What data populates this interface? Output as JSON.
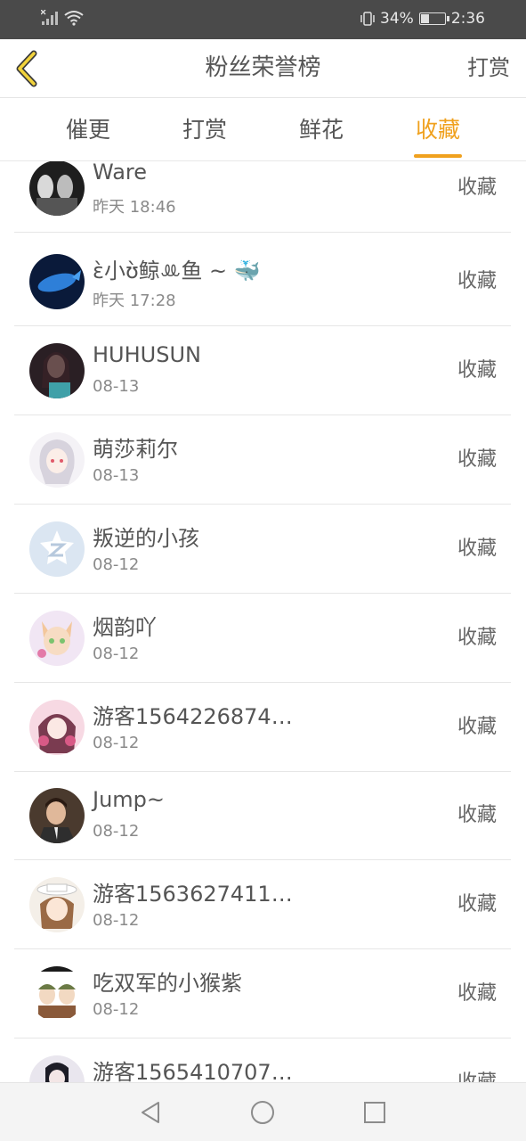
{
  "status_bar": {
    "battery_percent": "34%",
    "battery_level": 0.34,
    "time": "2:36",
    "icons": [
      "signal-icon",
      "wifi-icon",
      "vibrate-icon",
      "battery-icon"
    ]
  },
  "header": {
    "title": "粉丝荣誉榜",
    "action_label": "打赏",
    "back_icon": "chevron-left-icon",
    "accent_color": "#f0a11e"
  },
  "tabs": [
    {
      "label": "催更",
      "active": false
    },
    {
      "label": "打赏",
      "active": false
    },
    {
      "label": "鲜花",
      "active": false
    },
    {
      "label": "收藏",
      "active": true
    }
  ],
  "list": [
    {
      "name": "Ware",
      "time": "昨天 18:46",
      "action": "收藏",
      "avatar": "bw-photo"
    },
    {
      "name": "ɛ̀小ʊ̀鲸ꔛ鱼 ~ 🐳",
      "time": "昨天 17:28",
      "action": "收藏",
      "avatar": "blue-whale"
    },
    {
      "name": "HUHUSUN",
      "time": "08-13",
      "action": "收藏",
      "avatar": "portrait"
    },
    {
      "name": "萌莎莉尔",
      "time": "08-13",
      "action": "收藏",
      "avatar": "anime-girl"
    },
    {
      "name": "叛逆的小孩",
      "time": "08-12",
      "action": "收藏",
      "avatar": "default-z"
    },
    {
      "name": "烟韵吖",
      "time": "08-12",
      "action": "收藏",
      "avatar": "anime-fox"
    },
    {
      "name": "游客1564226874…",
      "time": "08-12",
      "action": "收藏",
      "avatar": "anime-pink"
    },
    {
      "name": "Jump~",
      "time": "08-12",
      "action": "收藏",
      "avatar": "man-portrait"
    },
    {
      "name": "游客1563627411…",
      "time": "08-12",
      "action": "收藏",
      "avatar": "anime-hat"
    },
    {
      "name": "吃双军的小猴紫",
      "time": "08-12",
      "action": "收藏",
      "avatar": "anime-pair"
    },
    {
      "name": "游客1565410707…",
      "time": "",
      "action": "收藏",
      "avatar": "anime-dark"
    }
  ],
  "nav_bar": {
    "icons": [
      "back-triangle-icon",
      "home-circle-icon",
      "recent-square-icon"
    ]
  }
}
